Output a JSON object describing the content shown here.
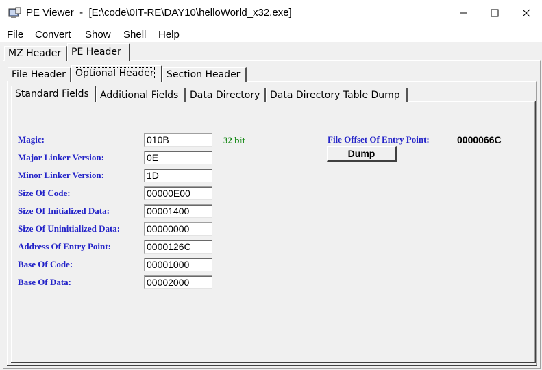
{
  "window": {
    "app_name": "PE Viewer",
    "title_separator": "  -  ",
    "file_path": "[E:\\code\\0IT-RE\\DAY10\\helloWorld_x32.exe]"
  },
  "menu": [
    "File",
    "Convert",
    "Show",
    "Shell",
    "Help"
  ],
  "top_tabs": [
    {
      "label": "MZ Header",
      "selected": false
    },
    {
      "label": "PE Header",
      "selected": true
    }
  ],
  "pe_tabs": [
    {
      "label": "File Header",
      "selected": false
    },
    {
      "label": "Optional Header",
      "selected": true
    },
    {
      "label": "Section Header",
      "selected": false
    }
  ],
  "opt_tabs": [
    {
      "label": "Standard Fields",
      "selected": true
    },
    {
      "label": "Additional Fields",
      "selected": false
    },
    {
      "label": "Data Directory",
      "selected": false
    },
    {
      "label": "Data Directory Table Dump",
      "selected": false
    }
  ],
  "fields": [
    {
      "label": "Magic:",
      "value": "010B"
    },
    {
      "label": "Major Linker Version:",
      "value": "0E"
    },
    {
      "label": "Minor Linker Version:",
      "value": "1D"
    },
    {
      "label": "Size Of Code:",
      "value": "00000E00"
    },
    {
      "label": "Size Of Initialized Data:",
      "value": "00001400"
    },
    {
      "label": "Size Of Uninitialized Data:",
      "value": "00000000"
    },
    {
      "label": "Address Of Entry Point:",
      "value": "0000126C"
    },
    {
      "label": "Base Of Code:",
      "value": "00001000"
    },
    {
      "label": "Base Of Data:",
      "value": "00002000"
    }
  ],
  "bitness": "32 bit",
  "entry_offset": {
    "label": "File Offset Of Entry Point:",
    "value": "0000066C"
  },
  "dump_button": "Dump",
  "colors": {
    "label_blue": "#2323c8",
    "bit_green": "#1a8a1a"
  }
}
